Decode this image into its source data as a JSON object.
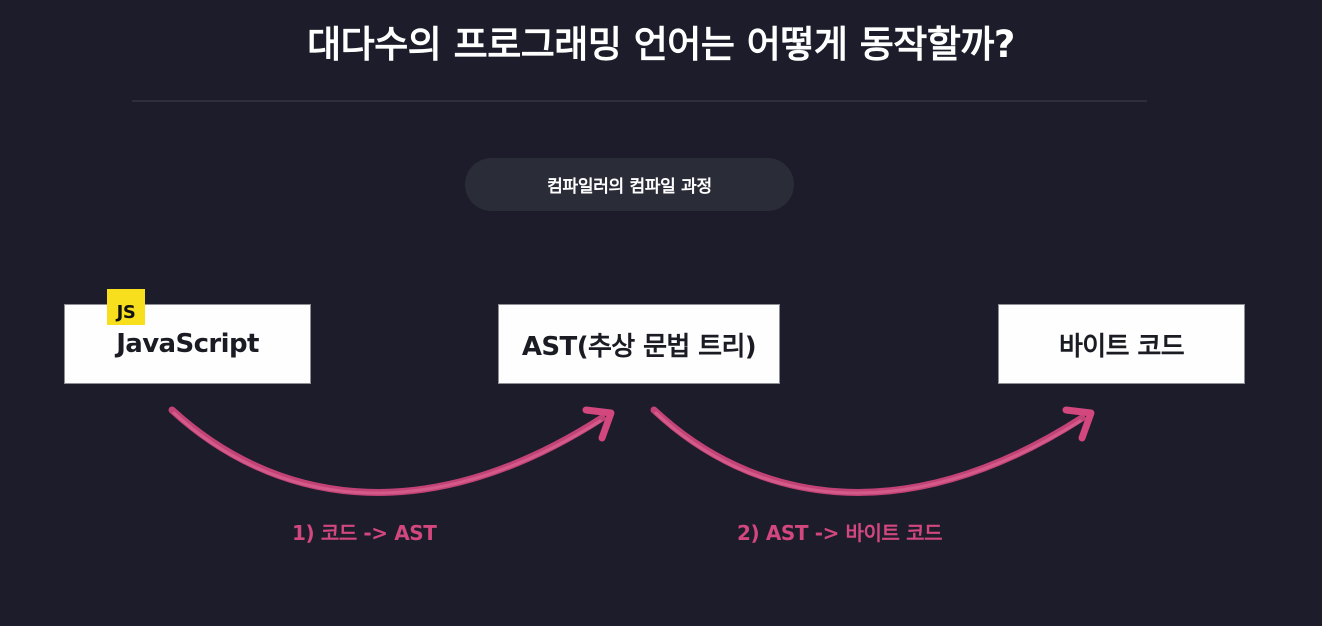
{
  "title": "대다수의 프로그래밍 언어는 어떻게 동작할까?",
  "section_pill": "컴파일러의 컴파일 과정",
  "nodes": {
    "javascript": "JavaScript",
    "js_badge": "JS",
    "ast": "AST(추상 문법 트리)",
    "bytecode": "바이트 코드"
  },
  "steps": {
    "step1": "1) 코드 -> AST",
    "step2": "2) AST -> 바이트 코드"
  },
  "colors": {
    "background": "#1c1c2a",
    "arrow": "#d1477e",
    "js_badge": "#f7df1e",
    "node_fill": "#fefefe"
  },
  "icons": [
    "javascript-logo-icon",
    "curved-arrow-icon"
  ]
}
